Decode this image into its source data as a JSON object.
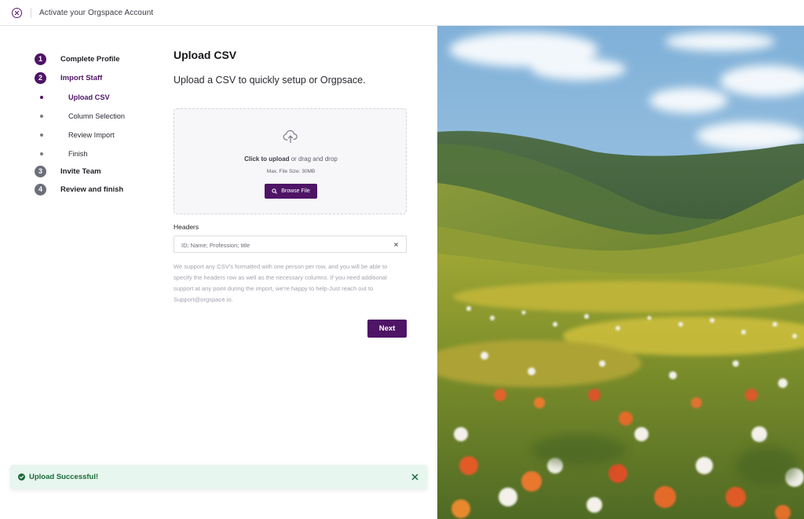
{
  "window": {
    "title": "Activate your Orgspace Account"
  },
  "stepper": {
    "steps": [
      {
        "number": "1",
        "label": "Complete Profile",
        "state": "done"
      },
      {
        "number": "2",
        "label": "Import Staff",
        "state": "active"
      },
      {
        "number": "3",
        "label": "Invite Team",
        "state": "pending"
      },
      {
        "number": "4",
        "label": "Review and finish",
        "state": "pending"
      }
    ],
    "substeps": [
      {
        "label": "Upload CSV",
        "state": "active"
      },
      {
        "label": "Column Selection",
        "state": "pending"
      },
      {
        "label": "Review Import",
        "state": "pending"
      },
      {
        "label": "Finish",
        "state": "pending"
      }
    ]
  },
  "main": {
    "title": "Upload CSV",
    "subtitle": "Upload a CSV to quickly setup or Orgpsace.",
    "dropzone": {
      "click_text": "Click to upload",
      "rest_text": "or drag and drop",
      "max_size": "Max. File Size: 30MB",
      "browse_label": "Browse File"
    },
    "headers": {
      "label": "Headers",
      "value": "ID; Name; Profession; title"
    },
    "help_text": "We support any CSV's formatted with one person per row, and you will be able to specify the headers row as well as the necessary columns. If you need additional support at any point during the import, we're happy to help-Just reach out to Support@orgspace.io.",
    "next_label": "Next"
  },
  "toast": {
    "message": "Upload Successful!",
    "color": "#1b6a3a"
  },
  "colors": {
    "accent": "#4e1466",
    "success_bg": "#e7f6ee"
  },
  "icons": [
    "close-icon",
    "upload-cloud-icon",
    "search-icon",
    "clear-icon",
    "check-circle-icon",
    "toast-close-icon"
  ]
}
